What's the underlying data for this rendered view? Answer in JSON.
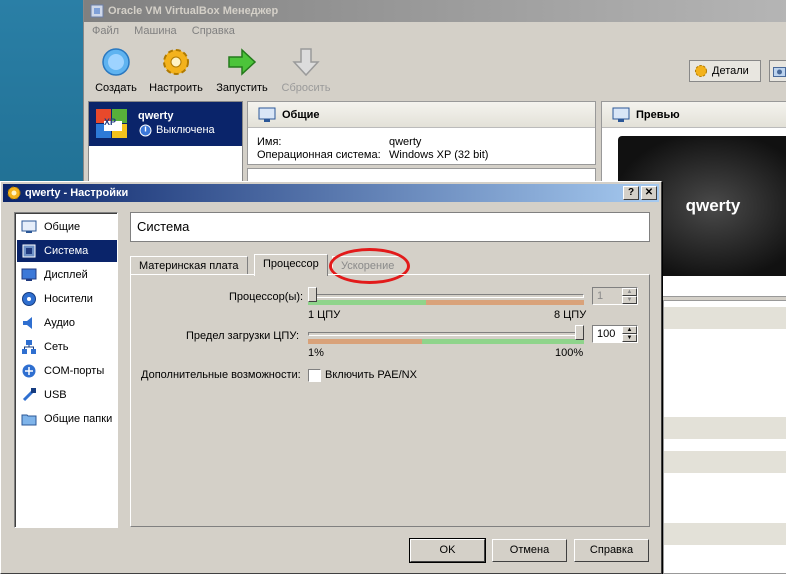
{
  "main_window": {
    "title": "Oracle VM VirtualBox Менеджер",
    "menu": [
      "Файл",
      "Машина",
      "Справка"
    ],
    "toolbar": {
      "create": "Создать",
      "settings": "Настроить",
      "start": "Запустить",
      "discard": "Сбросить"
    },
    "details_button": "Детали",
    "vm": {
      "name": "qwerty",
      "state": "Выключена",
      "os_badge": "XP"
    },
    "general_panel": {
      "title": "Общие",
      "rows": [
        {
          "label": "Имя:",
          "value": "qwerty"
        },
        {
          "label": "Операционная система:",
          "value": "Windows XP (32 bit)"
        }
      ]
    },
    "preview_panel": {
      "title": "Превью",
      "screen_text": "qwerty"
    }
  },
  "dialog": {
    "title": "qwerty - Настройки",
    "caption_buttons": {
      "help": "?",
      "close": "✕"
    },
    "nav": [
      {
        "label": "Общие",
        "icon": "monitor-general-icon",
        "selected": false
      },
      {
        "label": "Система",
        "icon": "chip-icon",
        "selected": true
      },
      {
        "label": "Дисплей",
        "icon": "display-icon",
        "selected": false
      },
      {
        "label": "Носители",
        "icon": "disc-icon",
        "selected": false
      },
      {
        "label": "Аудио",
        "icon": "speaker-icon",
        "selected": false
      },
      {
        "label": "Сеть",
        "icon": "network-icon",
        "selected": false
      },
      {
        "label": "COM-порты",
        "icon": "serial-port-icon",
        "selected": false
      },
      {
        "label": "USB",
        "icon": "usb-icon",
        "selected": false
      },
      {
        "label": "Общие папки",
        "icon": "folder-icon",
        "selected": false
      }
    ],
    "section_title": "Система",
    "tabs": [
      {
        "label": "Материнская плата",
        "state": "normal"
      },
      {
        "label": "Процессор",
        "state": "active"
      },
      {
        "label": "Ускорение",
        "state": "disabled"
      }
    ],
    "cpu": {
      "label": "Процессор(ы):",
      "value": "1",
      "min_label": "1 ЦПУ",
      "max_label": "8 ЦПУ",
      "fraction": 0.0
    },
    "cap": {
      "label": "Предел загрузки ЦПУ:",
      "value": "100",
      "min_label": "1%",
      "max_label": "100%",
      "fraction": 1.0
    },
    "extended": {
      "label": "Дополнительные возможности:",
      "checkbox_label": "Включить PAE/NX",
      "checked": false
    },
    "buttons": {
      "ok": "OK",
      "cancel": "Отмена",
      "help": "Справка"
    }
  },
  "colors": {
    "selection": "#0a246a",
    "zone_green": "#8fd48b",
    "zone_orange": "#d9a27a",
    "highlight_circle": "#e21a1a"
  }
}
